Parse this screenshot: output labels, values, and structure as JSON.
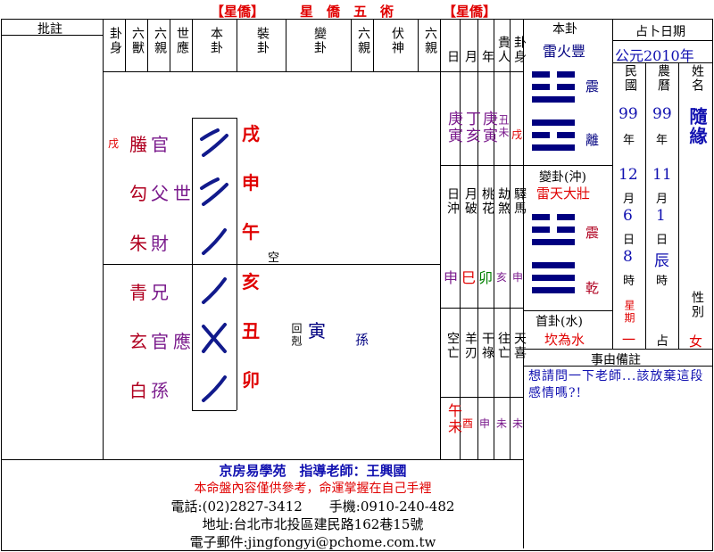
{
  "header": {
    "bracket_left": "【星僑】",
    "title": "星　僑　五　術",
    "bracket_right": "【星僑】"
  },
  "left_panel": {
    "title": "批註"
  },
  "columns": {
    "gua_shen": "卦身",
    "liu_shou": "六獸",
    "liu_qin": "六親",
    "shi_ying": "世應",
    "ben_gua": "本卦",
    "zhuang_gua": "裝卦",
    "bian_gua": "變卦",
    "liu_qin_2": "六親",
    "fu_shen": "伏神",
    "liu_qin_3": "六親"
  },
  "lines": [
    {
      "shen": "戌",
      "beast": "螣",
      "relative": "官",
      "role": "",
      "zhuang": "戌",
      "yao": "yin",
      "kong": ""
    },
    {
      "shen": "",
      "beast": "勾",
      "relative": "父",
      "role": "世",
      "zhuang": "申",
      "yao": "yin",
      "kong": ""
    },
    {
      "shen": "",
      "beast": "朱",
      "relative": "財",
      "role": "",
      "zhuang": "午",
      "yao": "yang",
      "kong": "空"
    },
    {
      "shen": "",
      "beast": "青",
      "relative": "兄",
      "role": "",
      "zhuang": "亥",
      "yao": "yang",
      "kong": ""
    },
    {
      "shen": "",
      "beast": "玄",
      "relative": "官",
      "role": "應",
      "zhuang": "丑",
      "yao": "moving-yin",
      "kong": ""
    },
    {
      "shen": "",
      "beast": "白",
      "relative": "孫",
      "role": "",
      "zhuang": "卯",
      "yao": "yang",
      "kong": ""
    }
  ],
  "bian_line5": {
    "note": "回剋",
    "branch": "寅",
    "relative": "孫"
  },
  "date_columns": {
    "headers": [
      "日",
      "月",
      "年",
      "貴人",
      "卦身"
    ],
    "day": "庚寅",
    "month": "丁亥",
    "year": "庚寅",
    "guiren": "丑未",
    "gua_shen": "戌",
    "row2_headers": [
      "日沖",
      "月破",
      "桃花",
      "劫煞",
      "驛馬"
    ],
    "row2_values": [
      "申",
      "巳",
      "卯",
      "亥",
      "申"
    ],
    "row3_headers": [
      "空亡",
      "羊刃",
      "干祿",
      "往亡",
      "天喜"
    ],
    "row3_values": [
      "午未",
      "酉",
      "申",
      "未",
      "未"
    ]
  },
  "gua_panel": {
    "ben_title": "本卦",
    "ben_name": "雷火豐",
    "ben_upper": "震",
    "ben_lower": "離",
    "bian_title": "變卦(沖)",
    "bian_name": "雷天大壯",
    "bian_upper": "震",
    "bian_lower": "乾",
    "shou_title": "首卦(水)",
    "shou_name": "坎為水"
  },
  "date_panel": {
    "title": "占卜日期",
    "year_label": "公元2010年",
    "min_guo": "民國",
    "nong_li": "農曆",
    "name_label": "姓名",
    "name": "隨緣",
    "roc_year": "99",
    "lunar_year": "99",
    "nian": "年",
    "nian2": "年",
    "month": "12",
    "lunar_month": "11",
    "yue": "月",
    "yue2": "月",
    "day": "6",
    "lunar_day": "1",
    "ri": "日",
    "ri2": "日",
    "hour": "8",
    "lunar_hour": "辰",
    "shi": "時",
    "shi2": "時",
    "weekday_label": "星期",
    "weekday": "一",
    "zhan": "占",
    "gender_label": "性別",
    "gender": "女"
  },
  "question": {
    "title": "事由備註",
    "text": "想請問一下老師...該放棄這段感情嗎?!"
  },
  "footer": {
    "line1": "京房易學苑　指導老師：王興國",
    "line2": "本命盤內容僅供參考，命運掌握在自己手裡",
    "line3": "電話:(02)2827-3412　　手機:0910-240-482",
    "line4": "地址:台北市北投區建民路162巷15號",
    "line5": "電子郵件:jingfongyi@pchome.com.tw"
  },
  "colors": {
    "accent_red": "#e00000",
    "accent_purple": "#7a1a8c",
    "accent_blue": "#1010b0",
    "navy": "#000080"
  }
}
